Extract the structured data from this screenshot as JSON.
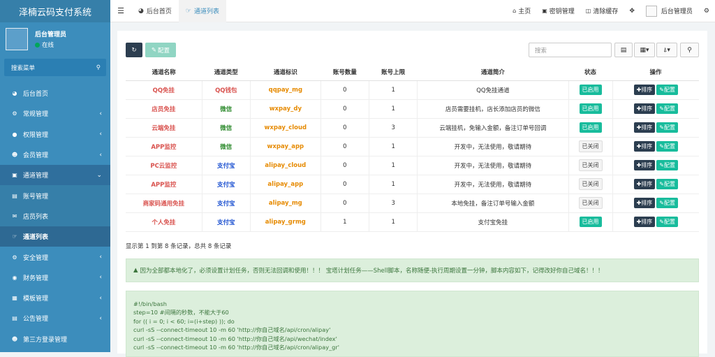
{
  "app": {
    "title": "泽楠云码支付系统"
  },
  "user": {
    "name": "后台管理员",
    "status": "在线"
  },
  "sidebar": {
    "search_label": "搜索菜单",
    "items": [
      {
        "label": "后台首页",
        "icon": "tachometer-icon"
      },
      {
        "label": "常规管理",
        "icon": "cogs-icon"
      },
      {
        "label": "权限管理",
        "icon": "group-icon"
      },
      {
        "label": "会员管理",
        "icon": "user-circle-icon"
      },
      {
        "label": "通道管理",
        "icon": "letter-a-icon"
      },
      {
        "label": "账号管理",
        "icon": "id-card-icon"
      },
      {
        "label": "店员列表",
        "icon": "wechat-icon"
      },
      {
        "label": "通道列表",
        "icon": "hand-pointer-icon"
      },
      {
        "label": "安全管理",
        "icon": "gear-icon"
      },
      {
        "label": "财务管理",
        "icon": "globe-icon"
      },
      {
        "label": "模板管理",
        "icon": "th-icon"
      },
      {
        "label": "公告管理",
        "icon": "calendar-icon"
      },
      {
        "label": "第三方登录管理",
        "icon": "users-icon"
      }
    ]
  },
  "topbar": {
    "tabs": [
      {
        "label": "后台首页"
      },
      {
        "label": "通道列表"
      }
    ],
    "links": [
      {
        "label": "主页"
      },
      {
        "label": "密钥管理"
      },
      {
        "label": "清除缓存"
      },
      {
        "label": "后台管理员"
      }
    ]
  },
  "toolbar": {
    "config_label": "配置",
    "search_placeholder": "搜索"
  },
  "table": {
    "headers": [
      "通道名称",
      "通道类型",
      "通道标识",
      "账号数量",
      "账号上限",
      "通道简介",
      "状态",
      "操作"
    ],
    "rows": [
      {
        "name": "QQ免挂",
        "type": "QQ钱包",
        "type_kind": "qq",
        "ident": "qqpay_mg",
        "count": "0",
        "limit": "1",
        "desc": "QQ免挂通道",
        "status": "已启用",
        "on": true
      },
      {
        "name": "店员免挂",
        "type": "微信",
        "type_kind": "wx",
        "ident": "wxpay_dy",
        "count": "0",
        "limit": "1",
        "desc": "店员需要挂机，店长添加店员的微信",
        "status": "已启用",
        "on": true
      },
      {
        "name": "云端免挂",
        "type": "微信",
        "type_kind": "wx",
        "ident": "wxpay_cloud",
        "count": "0",
        "limit": "3",
        "desc": "云端挂机，免输入金额，备注订单号回调",
        "status": "已启用",
        "on": true
      },
      {
        "name": "APP监控",
        "type": "微信",
        "type_kind": "wx",
        "ident": "wxpay_app",
        "count": "0",
        "limit": "1",
        "desc": "开发中，无法使用，敬请期待",
        "status": "已关闭",
        "on": false
      },
      {
        "name": "PC云监控",
        "type": "支付宝",
        "type_kind": "ali",
        "ident": "alipay_cloud",
        "count": "0",
        "limit": "1",
        "desc": "开发中，无法使用，敬请期待",
        "status": "已关闭",
        "on": false
      },
      {
        "name": "APP监控",
        "type": "支付宝",
        "type_kind": "ali",
        "ident": "alipay_app",
        "count": "0",
        "limit": "1",
        "desc": "开发中，无法使用，敬请期待",
        "status": "已关闭",
        "on": false
      },
      {
        "name": "商家码通用免挂",
        "type": "支付宝",
        "type_kind": "ali",
        "ident": "alipay_mg",
        "count": "0",
        "limit": "3",
        "desc": "本地免挂，备注订单号输入金额",
        "status": "已关闭",
        "on": false
      },
      {
        "name": "个人免挂",
        "type": "支付宝",
        "type_kind": "ali",
        "ident": "alipay_grmg",
        "count": "1",
        "limit": "1",
        "desc": "支付宝免挂",
        "status": "已启用",
        "on": true
      }
    ],
    "sort_label": "排序",
    "config_label": "配置"
  },
  "summary": "显示第 1 到第 8 条记录，总共 8 条记录",
  "notice": "因为全部都本地化了，必须设置计划任务，否则无法回调和使用！！！ 宝塔计划任务——Shell脚本，名称随便-执行周期设置一分钟，脚本内容如下，记得改好你自己域名！！！",
  "code_lines": [
    "#!/bin/bash",
    "step=10 #间隔的秒数，不能大于60",
    "for (( i = 0; i < 60; i=(i+step) )); do",
    "curl -sS --connect-timeout 10 -m 60 'http://你自己域名/api/cron/alipay'",
    "curl -sS --connect-timeout 10 -m 60 'http://你自己域名/api/wechat/index'",
    "curl -sS --connect-timeout 10 -m 60 'http://你自己域名/api/cron/alipay_gr'"
  ]
}
